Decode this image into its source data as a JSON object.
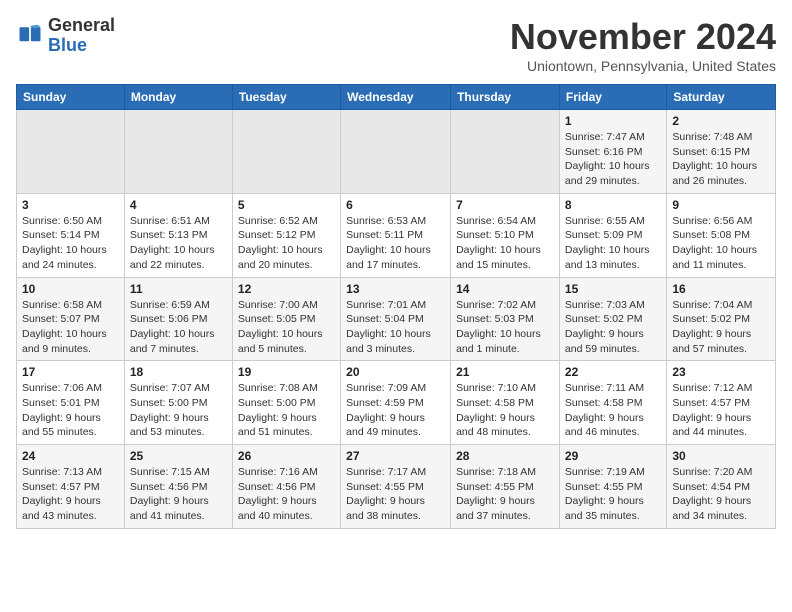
{
  "header": {
    "logo_general": "General",
    "logo_blue": "Blue",
    "month_title": "November 2024",
    "subtitle": "Uniontown, Pennsylvania, United States"
  },
  "days_of_week": [
    "Sunday",
    "Monday",
    "Tuesday",
    "Wednesday",
    "Thursday",
    "Friday",
    "Saturday"
  ],
  "weeks": [
    [
      {
        "day": "",
        "info": ""
      },
      {
        "day": "",
        "info": ""
      },
      {
        "day": "",
        "info": ""
      },
      {
        "day": "",
        "info": ""
      },
      {
        "day": "",
        "info": ""
      },
      {
        "day": "1",
        "info": "Sunrise: 7:47 AM\nSunset: 6:16 PM\nDaylight: 10 hours and 29 minutes."
      },
      {
        "day": "2",
        "info": "Sunrise: 7:48 AM\nSunset: 6:15 PM\nDaylight: 10 hours and 26 minutes."
      }
    ],
    [
      {
        "day": "3",
        "info": "Sunrise: 6:50 AM\nSunset: 5:14 PM\nDaylight: 10 hours and 24 minutes."
      },
      {
        "day": "4",
        "info": "Sunrise: 6:51 AM\nSunset: 5:13 PM\nDaylight: 10 hours and 22 minutes."
      },
      {
        "day": "5",
        "info": "Sunrise: 6:52 AM\nSunset: 5:12 PM\nDaylight: 10 hours and 20 minutes."
      },
      {
        "day": "6",
        "info": "Sunrise: 6:53 AM\nSunset: 5:11 PM\nDaylight: 10 hours and 17 minutes."
      },
      {
        "day": "7",
        "info": "Sunrise: 6:54 AM\nSunset: 5:10 PM\nDaylight: 10 hours and 15 minutes."
      },
      {
        "day": "8",
        "info": "Sunrise: 6:55 AM\nSunset: 5:09 PM\nDaylight: 10 hours and 13 minutes."
      },
      {
        "day": "9",
        "info": "Sunrise: 6:56 AM\nSunset: 5:08 PM\nDaylight: 10 hours and 11 minutes."
      }
    ],
    [
      {
        "day": "10",
        "info": "Sunrise: 6:58 AM\nSunset: 5:07 PM\nDaylight: 10 hours and 9 minutes."
      },
      {
        "day": "11",
        "info": "Sunrise: 6:59 AM\nSunset: 5:06 PM\nDaylight: 10 hours and 7 minutes."
      },
      {
        "day": "12",
        "info": "Sunrise: 7:00 AM\nSunset: 5:05 PM\nDaylight: 10 hours and 5 minutes."
      },
      {
        "day": "13",
        "info": "Sunrise: 7:01 AM\nSunset: 5:04 PM\nDaylight: 10 hours and 3 minutes."
      },
      {
        "day": "14",
        "info": "Sunrise: 7:02 AM\nSunset: 5:03 PM\nDaylight: 10 hours and 1 minute."
      },
      {
        "day": "15",
        "info": "Sunrise: 7:03 AM\nSunset: 5:02 PM\nDaylight: 9 hours and 59 minutes."
      },
      {
        "day": "16",
        "info": "Sunrise: 7:04 AM\nSunset: 5:02 PM\nDaylight: 9 hours and 57 minutes."
      }
    ],
    [
      {
        "day": "17",
        "info": "Sunrise: 7:06 AM\nSunset: 5:01 PM\nDaylight: 9 hours and 55 minutes."
      },
      {
        "day": "18",
        "info": "Sunrise: 7:07 AM\nSunset: 5:00 PM\nDaylight: 9 hours and 53 minutes."
      },
      {
        "day": "19",
        "info": "Sunrise: 7:08 AM\nSunset: 5:00 PM\nDaylight: 9 hours and 51 minutes."
      },
      {
        "day": "20",
        "info": "Sunrise: 7:09 AM\nSunset: 4:59 PM\nDaylight: 9 hours and 49 minutes."
      },
      {
        "day": "21",
        "info": "Sunrise: 7:10 AM\nSunset: 4:58 PM\nDaylight: 9 hours and 48 minutes."
      },
      {
        "day": "22",
        "info": "Sunrise: 7:11 AM\nSunset: 4:58 PM\nDaylight: 9 hours and 46 minutes."
      },
      {
        "day": "23",
        "info": "Sunrise: 7:12 AM\nSunset: 4:57 PM\nDaylight: 9 hours and 44 minutes."
      }
    ],
    [
      {
        "day": "24",
        "info": "Sunrise: 7:13 AM\nSunset: 4:57 PM\nDaylight: 9 hours and 43 minutes."
      },
      {
        "day": "25",
        "info": "Sunrise: 7:15 AM\nSunset: 4:56 PM\nDaylight: 9 hours and 41 minutes."
      },
      {
        "day": "26",
        "info": "Sunrise: 7:16 AM\nSunset: 4:56 PM\nDaylight: 9 hours and 40 minutes."
      },
      {
        "day": "27",
        "info": "Sunrise: 7:17 AM\nSunset: 4:55 PM\nDaylight: 9 hours and 38 minutes."
      },
      {
        "day": "28",
        "info": "Sunrise: 7:18 AM\nSunset: 4:55 PM\nDaylight: 9 hours and 37 minutes."
      },
      {
        "day": "29",
        "info": "Sunrise: 7:19 AM\nSunset: 4:55 PM\nDaylight: 9 hours and 35 minutes."
      },
      {
        "day": "30",
        "info": "Sunrise: 7:20 AM\nSunset: 4:54 PM\nDaylight: 9 hours and 34 minutes."
      }
    ]
  ]
}
